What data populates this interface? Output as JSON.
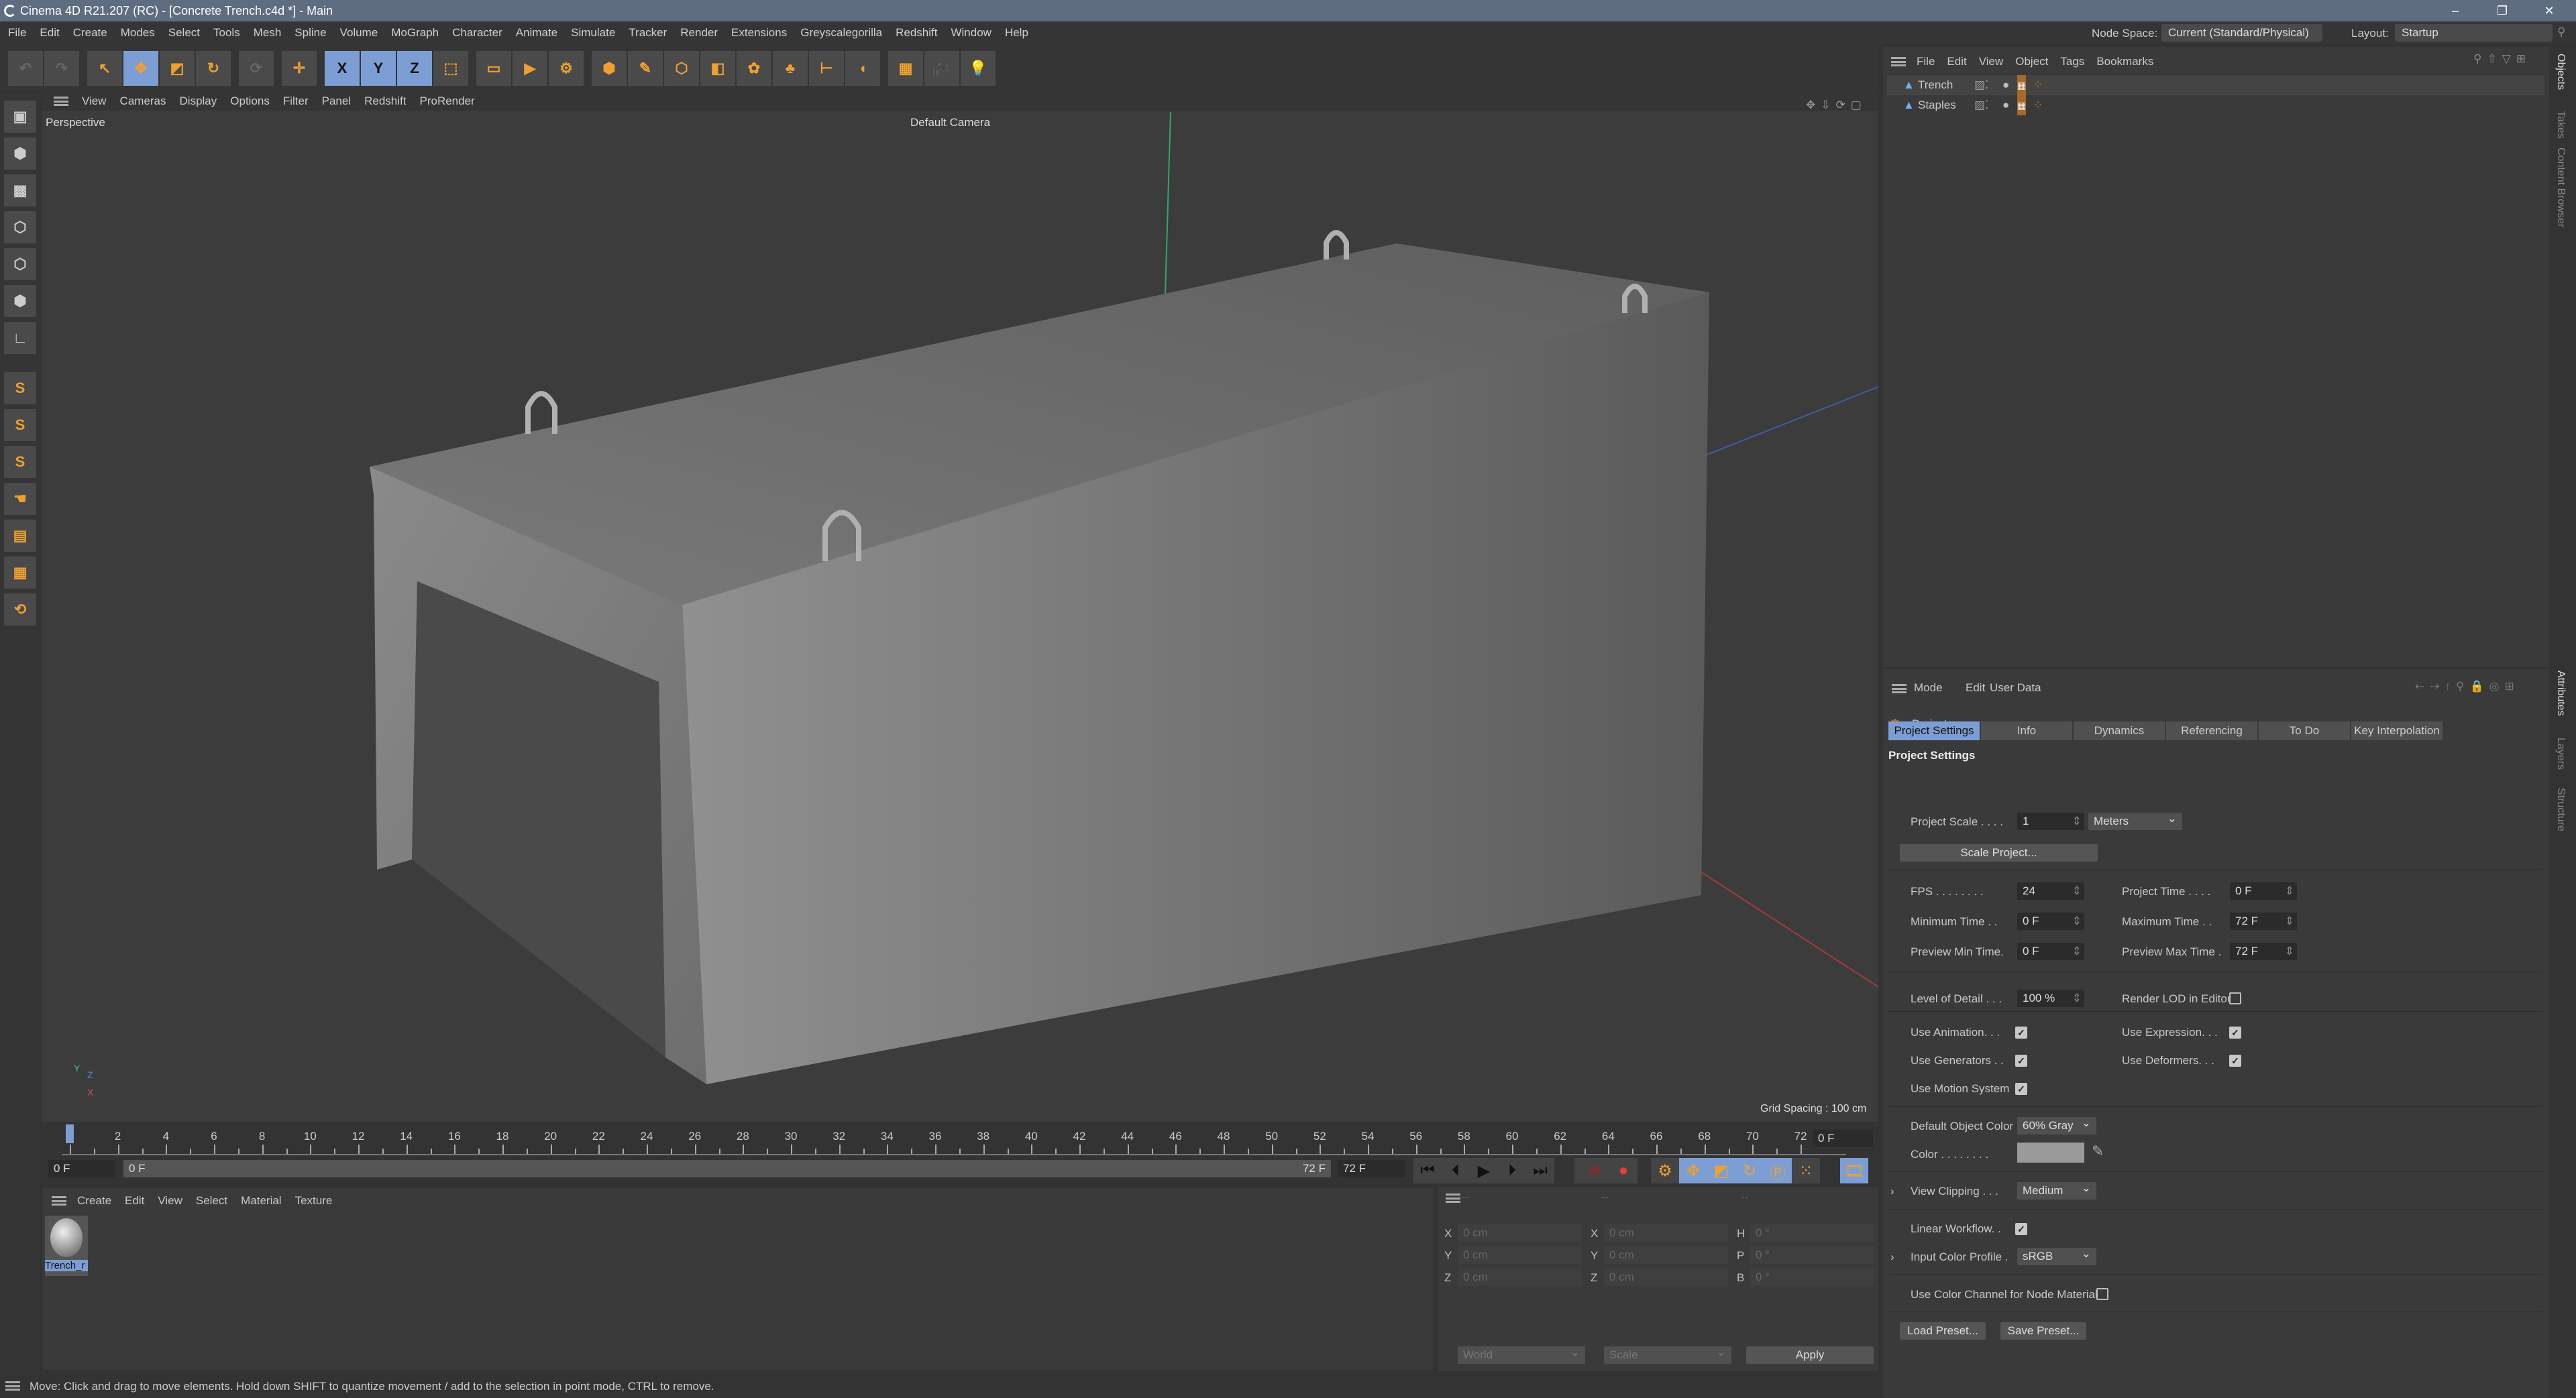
{
  "window": {
    "title": "Cinema 4D R21.207 (RC) - [Concrete Trench.c4d *] - Main",
    "controls": [
      "–",
      "❐",
      "✕"
    ]
  },
  "menu": [
    "File",
    "Edit",
    "Create",
    "Modes",
    "Select",
    "Tools",
    "Mesh",
    "Spline",
    "Volume",
    "MoGraph",
    "Character",
    "Animate",
    "Simulate",
    "Tracker",
    "Render",
    "Extensions",
    "Greyscalegorilla",
    "Redshift",
    "Window",
    "Help"
  ],
  "node_space": {
    "label": "Node Space:",
    "value": "Current (Standard/Physical)"
  },
  "layout": {
    "label": "Layout:",
    "value": "Startup"
  },
  "toolbar": [
    {
      "icon": "undo-icon",
      "glyph": "↶",
      "state": "disabled"
    },
    {
      "icon": "redo-icon",
      "glyph": "↷",
      "state": "disabled"
    },
    {
      "icon": "live-selection-icon",
      "glyph": "↖"
    },
    {
      "icon": "move-icon",
      "glyph": "✥",
      "state": "selected"
    },
    {
      "icon": "scale-icon",
      "glyph": "◩"
    },
    {
      "icon": "rotate-icon",
      "glyph": "↻"
    },
    {
      "icon": "recent-tools-icon",
      "glyph": "⟳",
      "state": "disabled"
    },
    {
      "icon": "move-tool-icon",
      "glyph": "✛"
    },
    {
      "icon": "x-axis-icon",
      "glyph": "X",
      "state": "selected"
    },
    {
      "icon": "y-axis-icon",
      "glyph": "Y",
      "state": "selected"
    },
    {
      "icon": "z-axis-icon",
      "glyph": "Z",
      "state": "selected"
    },
    {
      "icon": "coordinate-system-icon",
      "glyph": "⬚"
    },
    {
      "icon": "render-view-icon",
      "glyph": "▭"
    },
    {
      "icon": "render-icon",
      "glyph": "▶"
    },
    {
      "icon": "render-settings-icon",
      "glyph": "⚙"
    },
    {
      "icon": "cube-icon",
      "glyph": "⬢"
    },
    {
      "icon": "pen-icon",
      "glyph": "✎"
    },
    {
      "icon": "subdivision-icon",
      "glyph": "⬡"
    },
    {
      "icon": "extrude-icon",
      "glyph": "◧"
    },
    {
      "icon": "cloner-icon",
      "glyph": "✿"
    },
    {
      "icon": "mograph-icon",
      "glyph": "♣"
    },
    {
      "icon": "deformer-icon",
      "glyph": "⊢"
    },
    {
      "icon": "field-icon",
      "glyph": "◖"
    },
    {
      "icon": "floor-icon",
      "glyph": "▦"
    },
    {
      "icon": "camera-icon",
      "glyph": "🎥"
    },
    {
      "icon": "light-icon",
      "glyph": "💡"
    }
  ],
  "left_tools": [
    {
      "icon": "make-editable-icon",
      "glyph": "▣"
    },
    {
      "icon": "model-mode-icon",
      "glyph": "⬢"
    },
    {
      "icon": "texture-mode-icon",
      "glyph": "▩"
    },
    {
      "icon": "points-mode-icon",
      "glyph": "⬡"
    },
    {
      "icon": "edges-mode-icon",
      "glyph": "⬡"
    },
    {
      "icon": "polygons-mode-icon",
      "glyph": "⬢"
    },
    {
      "icon": "axis-icon",
      "glyph": "∟"
    },
    {
      "icon": "snap-icon",
      "glyph": "S"
    },
    {
      "icon": "snap-settings-icon",
      "glyph": "S"
    },
    {
      "icon": "workplane-snap-icon",
      "glyph": "S"
    },
    {
      "icon": "tweak-icon",
      "glyph": "☚"
    },
    {
      "icon": "workplane-icon",
      "glyph": "▤"
    },
    {
      "icon": "grid-icon",
      "glyph": "▦"
    },
    {
      "icon": "lock-workplane-icon",
      "glyph": "⟲"
    }
  ],
  "viewport": {
    "menu": [
      "View",
      "Cameras",
      "Display",
      "Options",
      "Filter",
      "Panel",
      "Redshift",
      "ProRender"
    ],
    "projection": "Perspective",
    "camera": "Default Camera",
    "grid_spacing": "Grid Spacing : 100 cm",
    "axis_labels": [
      "Y",
      "Z",
      "X"
    ]
  },
  "timeline": {
    "min": 0,
    "max": 72,
    "step": 2,
    "current": "0 F",
    "current_frame": 0,
    "start_field": "0 F",
    "range_start": "0 F",
    "range_end": "72 F",
    "end_field": "72 F"
  },
  "playback": [
    "go-to-start-icon",
    "previous-frame-icon",
    "play-icon",
    "next-frame-icon",
    "go-to-end-icon",
    "go-to-last-key-icon"
  ],
  "record": [
    "autokey-icon",
    "record-icon",
    "keyframe-settings-icon",
    "key-position-icon",
    "key-scale-icon",
    "key-rotation-icon",
    "key-parameter-icon",
    "key-pla-icon",
    "timeline-icon"
  ],
  "materials": {
    "menu": [
      "Create",
      "Edit",
      "View",
      "Select",
      "Material",
      "Texture"
    ],
    "items": [
      {
        "name": "Trench_r"
      }
    ]
  },
  "coords": {
    "headers": [
      "--",
      "--",
      "--"
    ],
    "rows": [
      [
        "X",
        "0 cm",
        "X",
        "0 cm",
        "H",
        "0 °"
      ],
      [
        "Y",
        "0 cm",
        "Y",
        "0 cm",
        "P",
        "0 °"
      ],
      [
        "Z",
        "0 cm",
        "Z",
        "0 cm",
        "B",
        "0 °"
      ]
    ],
    "space": "World",
    "mode": "Scale",
    "apply": "Apply"
  },
  "status": "Move: Click and drag to move elements. Hold down SHIFT to quantize movement / add to the selection in point mode, CTRL to remove.",
  "objects": {
    "menu": [
      "File",
      "Edit",
      "View",
      "Object",
      "Tags",
      "Bookmarks"
    ],
    "items": [
      {
        "name": "Trench"
      },
      {
        "name": "Staples"
      }
    ]
  },
  "side_tabs": [
    "Objects",
    "Takes",
    "Content Browser",
    "Attributes",
    "Layers",
    "Structure"
  ],
  "attributes": {
    "menu": [
      "Mode",
      "Edit",
      "User Data"
    ],
    "object": "Project",
    "tabs": [
      "Project Settings",
      "Info",
      "Dynamics",
      "Referencing",
      "To Do",
      "Key Interpolation"
    ],
    "active_tab": "Project Settings",
    "section": "Project Settings",
    "project_scale": {
      "label": "Project Scale . . . .",
      "value": "1",
      "unit": "Meters"
    },
    "scale_button": "Scale Project...",
    "time_left": [
      {
        "label": "FPS . . . . . . . .",
        "value": "24"
      },
      {
        "label": "Minimum Time . .",
        "value": "0 F"
      },
      {
        "label": "Preview Min Time.",
        "value": "0 F"
      }
    ],
    "time_right": [
      {
        "label": "Project Time . . . .",
        "value": "0 F"
      },
      {
        "label": "Maximum Time . .",
        "value": "72 F"
      },
      {
        "label": "Preview Max Time .",
        "value": "72 F"
      }
    ],
    "lod": {
      "label": "Level of Detail . . .",
      "value": "100 %"
    },
    "render_lod": {
      "label": "Render LOD in Editor",
      "checked": false
    },
    "checks_left": [
      {
        "label": "Use Animation. . .",
        "checked": true
      },
      {
        "label": "Use Generators . .",
        "checked": true
      },
      {
        "label": "Use Motion System",
        "checked": true
      }
    ],
    "checks_right": [
      {
        "label": "Use Expression. . .",
        "checked": true
      },
      {
        "label": "Use Deformers. . .",
        "checked": true
      }
    ],
    "default_color": {
      "label": "Default Object Color",
      "value": "60% Gray"
    },
    "color": {
      "label": "Color . . . . . . . .",
      "swatch": "#9a9a9a"
    },
    "view_clipping": {
      "label": "View Clipping . . .",
      "value": "Medium"
    },
    "linear_workflow": {
      "label": "Linear Workflow. .",
      "checked": true
    },
    "input_profile": {
      "label": "Input Color Profile .",
      "value": "sRGB"
    },
    "color_channel": {
      "label": "Use Color Channel for Node Material",
      "checked": false
    },
    "load_preset": "Load Preset...",
    "save_preset": "Save Preset..."
  },
  "colors": {
    "accent": "#7c9ed4",
    "icon_orange": "#f0a030",
    "bg": "#3a3a3a"
  }
}
